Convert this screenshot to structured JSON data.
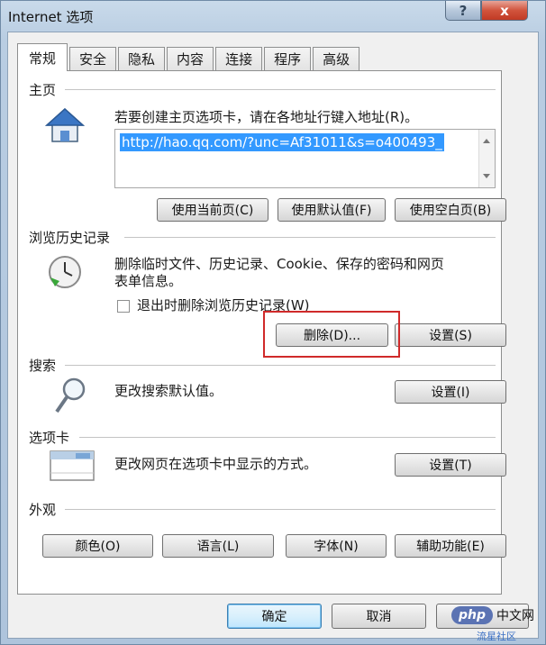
{
  "window": {
    "title": "Internet 选项",
    "help_label": "?",
    "close_label": "x"
  },
  "tabs": [
    {
      "label": "常规"
    },
    {
      "label": "安全"
    },
    {
      "label": "隐私"
    },
    {
      "label": "内容"
    },
    {
      "label": "连接"
    },
    {
      "label": "程序"
    },
    {
      "label": "高级"
    }
  ],
  "home": {
    "section_label": "主页",
    "instruction": "若要创建主页选项卡，请在各地址行键入地址(R)。",
    "url": "http://hao.qq.com/?unc=Af31011&s=o400493_",
    "use_current": "使用当前页(C)",
    "use_default": "使用默认值(F)",
    "use_blank": "使用空白页(B)"
  },
  "history": {
    "section_label": "浏览历史记录",
    "description_line1": "删除临时文件、历史记录、Cookie、保存的密码和网页",
    "description_line2": "表单信息。",
    "checkbox_label": "退出时删除浏览历史记录(W)",
    "checkbox_checked": false,
    "delete_button": "删除(D)...",
    "settings_button": "设置(S)"
  },
  "search": {
    "section_label": "搜索",
    "description": "更改搜索默认值。",
    "settings_button": "设置(I)"
  },
  "tabs_section": {
    "section_label": "选项卡",
    "description": "更改网页在选项卡中显示的方式。",
    "settings_button": "设置(T)"
  },
  "appearance": {
    "section_label": "外观",
    "colors_button": "颜色(O)",
    "languages_button": "语言(L)",
    "fonts_button": "字体(N)",
    "accessibility_button": "辅助功能(E)"
  },
  "footer": {
    "ok_button": "确定",
    "cancel_button": "取消"
  },
  "watermark": {
    "logo": "php",
    "text": "中文网",
    "small": "流星社区"
  },
  "colors": {
    "highlight": "#d02a2a",
    "selection": "#3399ff",
    "close": "#c13a24"
  }
}
